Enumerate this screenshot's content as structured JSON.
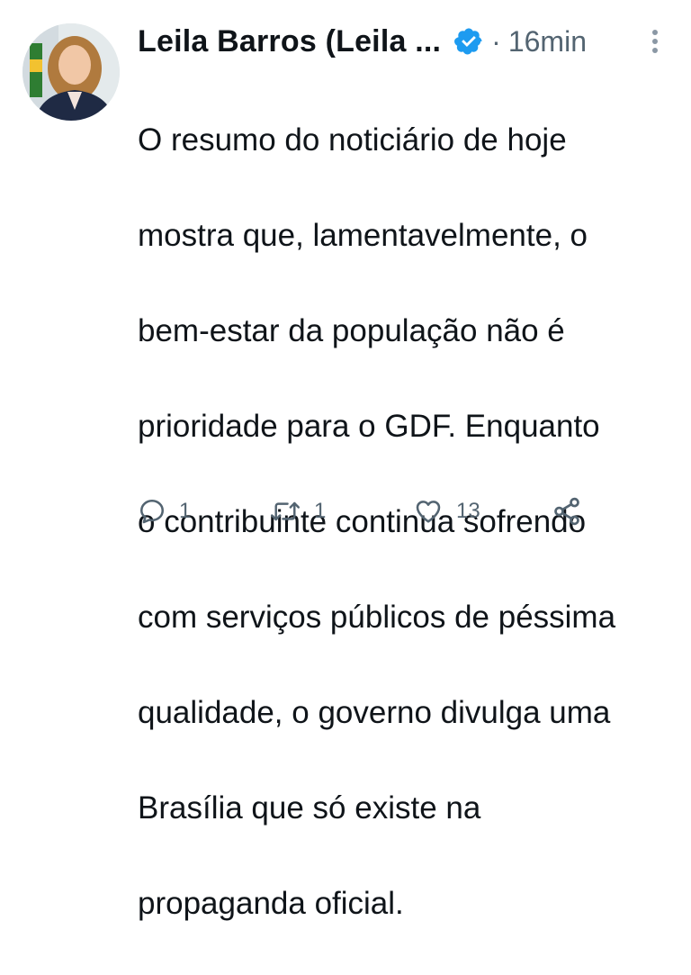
{
  "tweet": {
    "author": {
      "display_name": "Leila Barros (Leila ...",
      "verified": true
    },
    "separator": "·",
    "time": "16min",
    "text_lines": [
      "O resumo do noticiário de hoje",
      "mostra que, lamentavelmente, o",
      "bem-estar da população não é",
      "prioridade para o GDF. Enquanto",
      "o contribuinte continua sofrendo",
      "com serviços públicos de péssima",
      "qualidade, o governo divulga uma",
      "Brasília que só existe na",
      "propaganda oficial."
    ],
    "actions": {
      "reply": {
        "icon": "reply-icon",
        "count": "1"
      },
      "retweet": {
        "icon": "retweet-icon",
        "count": "1"
      },
      "like": {
        "icon": "heart-icon",
        "count": "13"
      },
      "share": {
        "icon": "share-icon"
      }
    }
  },
  "colors": {
    "text_primary": "#0f1419",
    "text_secondary": "#536471",
    "verified_blue": "#1d9bf0"
  }
}
